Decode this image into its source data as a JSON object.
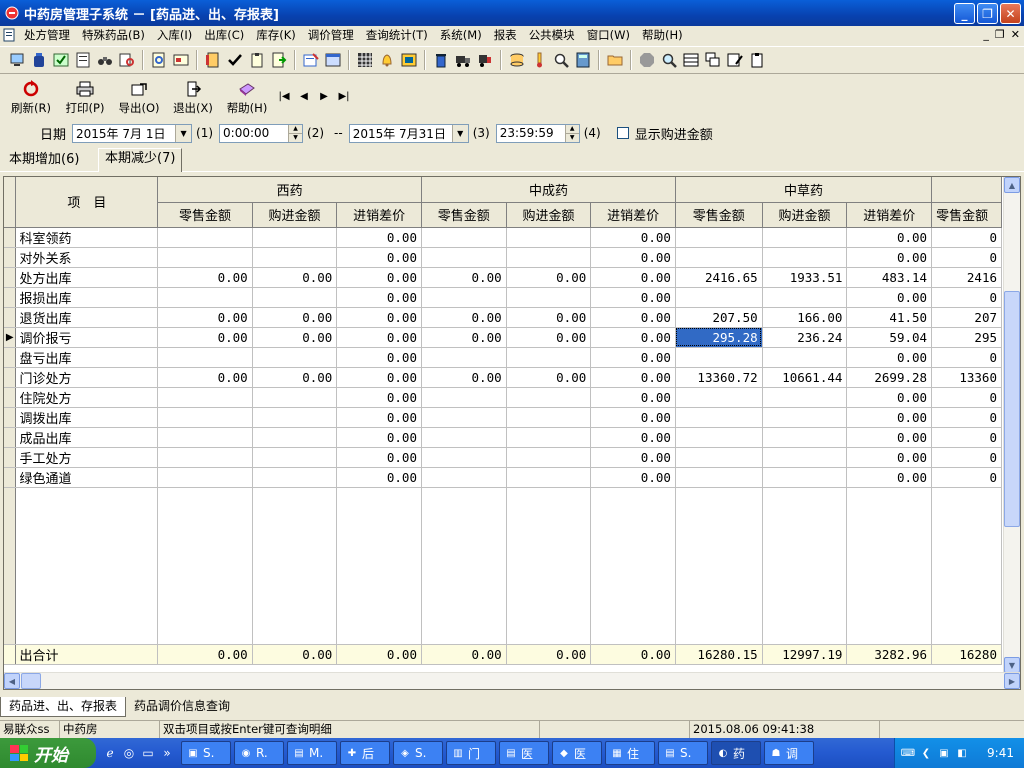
{
  "window": {
    "title": "中药房管理子系统 － [药品进、出、存报表]",
    "btn_min": "_",
    "btn_max": "❐",
    "btn_close": "✕"
  },
  "menu": [
    "处方管理",
    "特殊药品(B)",
    "入库(I)",
    "出库(C)",
    "库存(K)",
    "调价管理",
    "查询统计(T)",
    "系统(M)",
    "报表",
    "公共模块",
    "窗口(W)",
    "帮助(H)"
  ],
  "mdi_buttons": [
    "_",
    "❐",
    "✕"
  ],
  "toolbar2": {
    "refresh": "刷新(R)",
    "print": "打印(P)",
    "export": "导出(O)",
    "exit": "退出(X)",
    "help": "帮助(H)",
    "nav": [
      "|◀",
      "◀",
      "▶",
      "▶|"
    ]
  },
  "filter": {
    "label": "日期",
    "start_date": "2015年 7月 1日",
    "start_time": "0:00:00",
    "start_date_key": "(1)",
    "start_time_key": "(2)",
    "separator": "--",
    "end_date": "2015年 7月31日",
    "end_date_key": "(3)",
    "end_time": "23:59:59",
    "end_time_key": "(4)",
    "show_purchase_label": "显示购进金额"
  },
  "tabs": [
    "本期增加(6)",
    "本期减少(7)"
  ],
  "grid": {
    "item_header": "项　目",
    "groups": [
      "西药",
      "中成药",
      "中草药",
      ""
    ],
    "subheaders": [
      "零售金额",
      "购进金额",
      "进销差价",
      "零售金额",
      "购进金额",
      "进销差价",
      "零售金额",
      "购进金额",
      "进销差价",
      "零售金额"
    ],
    "current_row_marker": "▶",
    "rows": [
      {
        "item": "科室领药",
        "values": [
          "",
          "",
          "0.00",
          "",
          "",
          "0.00",
          "",
          "",
          "0.00",
          "0"
        ]
      },
      {
        "item": "对外关系",
        "values": [
          "",
          "",
          "0.00",
          "",
          "",
          "0.00",
          "",
          "",
          "0.00",
          "0"
        ]
      },
      {
        "item": "处方出库",
        "values": [
          "0.00",
          "0.00",
          "0.00",
          "0.00",
          "0.00",
          "0.00",
          "2416.65",
          "1933.51",
          "483.14",
          "2416"
        ]
      },
      {
        "item": "报损出库",
        "values": [
          "",
          "",
          "0.00",
          "",
          "",
          "0.00",
          "",
          "",
          "0.00",
          "0"
        ]
      },
      {
        "item": "退货出库",
        "values": [
          "0.00",
          "0.00",
          "0.00",
          "0.00",
          "0.00",
          "0.00",
          "207.50",
          "166.00",
          "41.50",
          "207"
        ]
      },
      {
        "item": "调价报亏",
        "values": [
          "0.00",
          "0.00",
          "0.00",
          "0.00",
          "0.00",
          "0.00",
          "295.28",
          "236.24",
          "59.04",
          "295"
        ]
      },
      {
        "item": "盘亏出库",
        "values": [
          "",
          "",
          "0.00",
          "",
          "",
          "0.00",
          "",
          "",
          "0.00",
          "0"
        ]
      },
      {
        "item": "门诊处方",
        "values": [
          "0.00",
          "0.00",
          "0.00",
          "0.00",
          "0.00",
          "0.00",
          "13360.72",
          "10661.44",
          "2699.28",
          "13360"
        ]
      },
      {
        "item": "住院处方",
        "values": [
          "",
          "",
          "0.00",
          "",
          "",
          "0.00",
          "",
          "",
          "0.00",
          "0"
        ]
      },
      {
        "item": "调拨出库",
        "values": [
          "",
          "",
          "0.00",
          "",
          "",
          "0.00",
          "",
          "",
          "0.00",
          "0"
        ]
      },
      {
        "item": "成品出库",
        "values": [
          "",
          "",
          "0.00",
          "",
          "",
          "0.00",
          "",
          "",
          "0.00",
          "0"
        ]
      },
      {
        "item": "手工处方",
        "values": [
          "",
          "",
          "0.00",
          "",
          "",
          "0.00",
          "",
          "",
          "0.00",
          "0"
        ]
      },
      {
        "item": "绿色通道",
        "values": [
          "",
          "",
          "0.00",
          "",
          "",
          "0.00",
          "",
          "",
          "0.00",
          "0"
        ]
      }
    ],
    "total": {
      "item": "出合计",
      "values": [
        "0.00",
        "0.00",
        "0.00",
        "0.00",
        "0.00",
        "0.00",
        "16280.15",
        "12997.19",
        "3282.96",
        "16280"
      ]
    }
  },
  "bottom_tabs": [
    "药品进、出、存报表",
    "药品调价信息查询"
  ],
  "status": [
    "易联众ss",
    "中药房",
    "双击项目或按Enter键可查询明细",
    "",
    "2015.08.06 09:41:38",
    ""
  ],
  "taskbar": {
    "start": "开始",
    "tasks": [
      {
        "icon": "▣",
        "label": "S."
      },
      {
        "icon": "◉",
        "label": "R."
      },
      {
        "icon": "▤",
        "label": "M."
      },
      {
        "icon": "✚",
        "label": "后"
      },
      {
        "icon": "◈",
        "label": "S."
      },
      {
        "icon": "▥",
        "label": "门"
      },
      {
        "icon": "▤",
        "label": "医"
      },
      {
        "icon": "◆",
        "label": "医"
      },
      {
        "icon": "▦",
        "label": "住"
      },
      {
        "icon": "▤",
        "label": "S."
      },
      {
        "icon": "◐",
        "label": "药"
      },
      {
        "icon": "☗",
        "label": "调"
      }
    ],
    "clock": "9:41"
  },
  "colors": {
    "selection": "#316ac5",
    "total_row": "#fdfce0",
    "title_bar": "#0842b0"
  }
}
